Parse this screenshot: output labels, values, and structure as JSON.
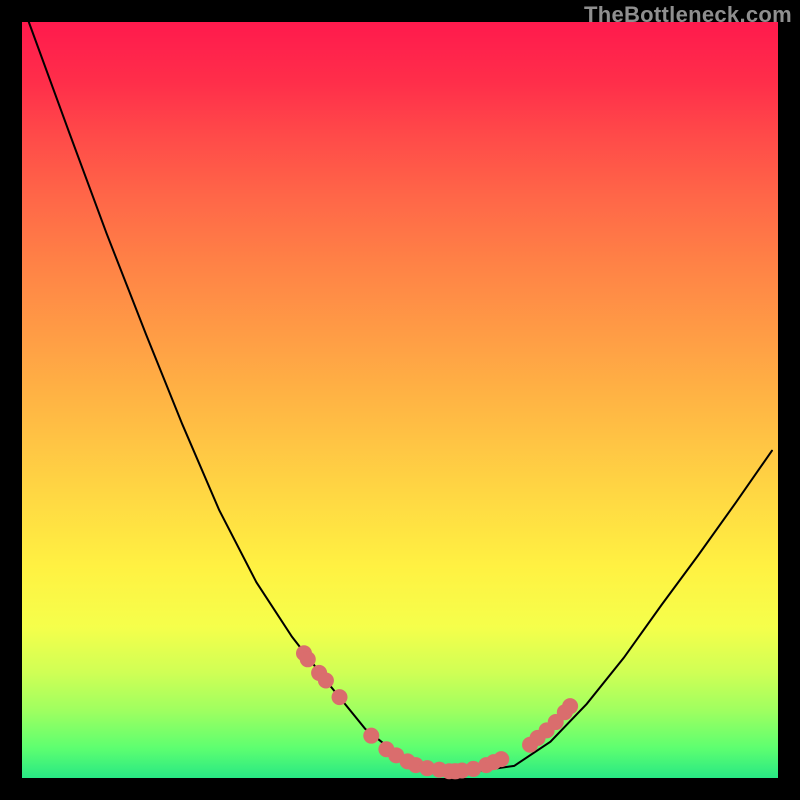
{
  "watermark": "TheBottleneck.com",
  "chart_data": {
    "type": "line",
    "title": "",
    "xlabel": "",
    "ylabel": "",
    "xlim": [
      0,
      100
    ],
    "ylim": [
      0,
      100
    ],
    "grid": false,
    "legend": false,
    "series": [
      {
        "name": "curve",
        "x": [
          0.9,
          6.2,
          11.2,
          16.4,
          21.2,
          26.1,
          31.0,
          35.7,
          40.6,
          45.4,
          50.3,
          55.2,
          60.1,
          65.1,
          69.9,
          74.7,
          79.6,
          84.6,
          89.4,
          94.4,
          99.2
        ],
        "y": [
          100.0,
          85.5,
          72.0,
          58.7,
          46.8,
          35.4,
          25.9,
          18.7,
          12.4,
          6.5,
          2.6,
          1.1,
          0.9,
          1.6,
          4.8,
          9.8,
          15.9,
          22.9,
          29.4,
          36.4,
          43.3
        ],
        "stroke": "#000000",
        "stroke_width": 2
      },
      {
        "name": "dots",
        "x": [
          37.3,
          37.8,
          39.3,
          40.2,
          42.0,
          46.2,
          48.2,
          49.5,
          51.0,
          52.1,
          53.6,
          55.2,
          56.5,
          57.2,
          57.4,
          58.2,
          59.7,
          61.4,
          62.4,
          63.4,
          67.2,
          68.2,
          69.4,
          70.6,
          71.8,
          72.5
        ],
        "y": [
          16.5,
          15.7,
          13.9,
          12.9,
          10.7,
          5.6,
          3.8,
          3.0,
          2.2,
          1.7,
          1.3,
          1.1,
          0.9,
          0.9,
          0.9,
          1.0,
          1.2,
          1.7,
          2.1,
          2.5,
          4.4,
          5.3,
          6.3,
          7.4,
          8.7,
          9.5
        ],
        "marker": "circle",
        "marker_color": "#da6d6d",
        "marker_radius": 8
      }
    ]
  }
}
